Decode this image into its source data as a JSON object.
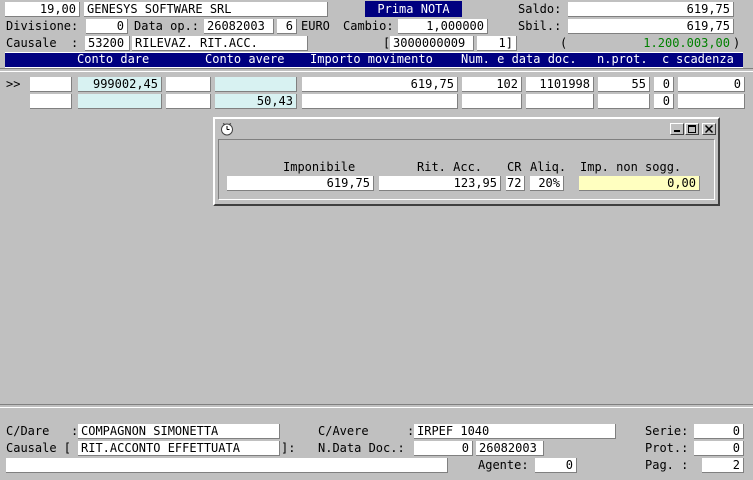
{
  "header": {
    "amount_top": "19,00",
    "company": "GENESYS SOFTWARE SRL",
    "title": "Prima NOTA",
    "saldo_label": "Saldo:",
    "saldo_value": "619,75",
    "divisione_label": "Divisione:",
    "divisione_value": "0",
    "data_op_label": "Data op.:",
    "data_op_value": "26082003",
    "data_op_extra": "6",
    "currency": "EURO",
    "cambio_label": "Cambio:",
    "cambio_value": "1,000000",
    "sbil_label": "Sbil.:",
    "sbil_value": "619,75",
    "causale_label": "Causale  :",
    "causale_code": "53200",
    "causale_desc": "RILEVAZ. RIT.ACC.",
    "ref_open": "[",
    "ref_value": "3000000009",
    "ref_extra": "1]",
    "paren_open": "(",
    "paren_value": "1.200.003,00",
    "paren_close": ")"
  },
  "columns": [
    "Conto dare",
    "Conto avere",
    "Importo movimento",
    "Num. e data doc.",
    "n.prot.",
    "c",
    "scadenza"
  ],
  "rows": [
    {
      "marker": ">>",
      "conto_dare": "999002,45",
      "importo": "619,75",
      "num_doc": "102",
      "data_doc": "1101998",
      "prot": "55",
      "c": "0",
      "scadenza": "0"
    },
    {
      "conto_avere": "50,43",
      "c": "0"
    }
  ],
  "dialog": {
    "imponibile_label": "Imponibile",
    "imponibile_value": "619,75",
    "rit_label": "Rit. Acc.",
    "rit_value": "123,95",
    "cr_label": "CR",
    "cr_value": "72",
    "aliq_label": "Aliq.",
    "aliq_value": "20%",
    "imp_label": "Imp. non sogg.",
    "imp_value": "0,00"
  },
  "footer": {
    "cdare_label": "C/Dare   :",
    "cdare_value": "COMPAGNON SIMONETTA",
    "cavere_label": "C/Avere",
    "cavere_colon": ":",
    "cavere_value": "IRPEF 1040",
    "serie_label": "Serie:",
    "serie_value": "0",
    "causale_label": "Causale [",
    "causale_value": "RIT.ACCONTO EFFETTUATA",
    "causale_close": "]:",
    "ndata_label": "N.Data Doc.:",
    "ndata_num": "0",
    "ndata_date": "26082003",
    "prot_label": "Prot.:",
    "prot_value": "0",
    "agente_label": "Agente:",
    "agente_value": "0",
    "pag_label": "Pag. :",
    "pag_value": "2"
  }
}
